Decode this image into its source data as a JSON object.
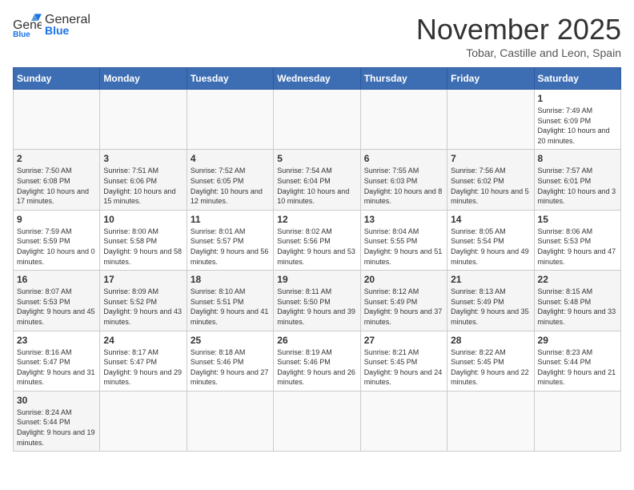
{
  "logo": {
    "text_general": "General",
    "text_blue": "Blue"
  },
  "header": {
    "month_year": "November 2025",
    "location": "Tobar, Castille and Leon, Spain"
  },
  "weekdays": [
    "Sunday",
    "Monday",
    "Tuesday",
    "Wednesday",
    "Thursday",
    "Friday",
    "Saturday"
  ],
  "weeks": [
    [
      null,
      null,
      null,
      null,
      null,
      null,
      {
        "day": "1",
        "sunrise": "7:49 AM",
        "sunset": "6:09 PM",
        "daylight": "10 hours and 20 minutes."
      }
    ],
    [
      {
        "day": "2",
        "sunrise": "7:50 AM",
        "sunset": "6:08 PM",
        "daylight": "10 hours and 17 minutes."
      },
      {
        "day": "3",
        "sunrise": "7:51 AM",
        "sunset": "6:06 PM",
        "daylight": "10 hours and 15 minutes."
      },
      {
        "day": "4",
        "sunrise": "7:52 AM",
        "sunset": "6:05 PM",
        "daylight": "10 hours and 12 minutes."
      },
      {
        "day": "5",
        "sunrise": "7:54 AM",
        "sunset": "6:04 PM",
        "daylight": "10 hours and 10 minutes."
      },
      {
        "day": "6",
        "sunrise": "7:55 AM",
        "sunset": "6:03 PM",
        "daylight": "10 hours and 8 minutes."
      },
      {
        "day": "7",
        "sunrise": "7:56 AM",
        "sunset": "6:02 PM",
        "daylight": "10 hours and 5 minutes."
      },
      {
        "day": "8",
        "sunrise": "7:57 AM",
        "sunset": "6:01 PM",
        "daylight": "10 hours and 3 minutes."
      }
    ],
    [
      {
        "day": "9",
        "sunrise": "7:59 AM",
        "sunset": "5:59 PM",
        "daylight": "10 hours and 0 minutes."
      },
      {
        "day": "10",
        "sunrise": "8:00 AM",
        "sunset": "5:58 PM",
        "daylight": "9 hours and 58 minutes."
      },
      {
        "day": "11",
        "sunrise": "8:01 AM",
        "sunset": "5:57 PM",
        "daylight": "9 hours and 56 minutes."
      },
      {
        "day": "12",
        "sunrise": "8:02 AM",
        "sunset": "5:56 PM",
        "daylight": "9 hours and 53 minutes."
      },
      {
        "day": "13",
        "sunrise": "8:04 AM",
        "sunset": "5:55 PM",
        "daylight": "9 hours and 51 minutes."
      },
      {
        "day": "14",
        "sunrise": "8:05 AM",
        "sunset": "5:54 PM",
        "daylight": "9 hours and 49 minutes."
      },
      {
        "day": "15",
        "sunrise": "8:06 AM",
        "sunset": "5:53 PM",
        "daylight": "9 hours and 47 minutes."
      }
    ],
    [
      {
        "day": "16",
        "sunrise": "8:07 AM",
        "sunset": "5:53 PM",
        "daylight": "9 hours and 45 minutes."
      },
      {
        "day": "17",
        "sunrise": "8:09 AM",
        "sunset": "5:52 PM",
        "daylight": "9 hours and 43 minutes."
      },
      {
        "day": "18",
        "sunrise": "8:10 AM",
        "sunset": "5:51 PM",
        "daylight": "9 hours and 41 minutes."
      },
      {
        "day": "19",
        "sunrise": "8:11 AM",
        "sunset": "5:50 PM",
        "daylight": "9 hours and 39 minutes."
      },
      {
        "day": "20",
        "sunrise": "8:12 AM",
        "sunset": "5:49 PM",
        "daylight": "9 hours and 37 minutes."
      },
      {
        "day": "21",
        "sunrise": "8:13 AM",
        "sunset": "5:49 PM",
        "daylight": "9 hours and 35 minutes."
      },
      {
        "day": "22",
        "sunrise": "8:15 AM",
        "sunset": "5:48 PM",
        "daylight": "9 hours and 33 minutes."
      }
    ],
    [
      {
        "day": "23",
        "sunrise": "8:16 AM",
        "sunset": "5:47 PM",
        "daylight": "9 hours and 31 minutes."
      },
      {
        "day": "24",
        "sunrise": "8:17 AM",
        "sunset": "5:47 PM",
        "daylight": "9 hours and 29 minutes."
      },
      {
        "day": "25",
        "sunrise": "8:18 AM",
        "sunset": "5:46 PM",
        "daylight": "9 hours and 27 minutes."
      },
      {
        "day": "26",
        "sunrise": "8:19 AM",
        "sunset": "5:46 PM",
        "daylight": "9 hours and 26 minutes."
      },
      {
        "day": "27",
        "sunrise": "8:21 AM",
        "sunset": "5:45 PM",
        "daylight": "9 hours and 24 minutes."
      },
      {
        "day": "28",
        "sunrise": "8:22 AM",
        "sunset": "5:45 PM",
        "daylight": "9 hours and 22 minutes."
      },
      {
        "day": "29",
        "sunrise": "8:23 AM",
        "sunset": "5:44 PM",
        "daylight": "9 hours and 21 minutes."
      }
    ],
    [
      {
        "day": "30",
        "sunrise": "8:24 AM",
        "sunset": "5:44 PM",
        "daylight": "9 hours and 19 minutes."
      },
      null,
      null,
      null,
      null,
      null,
      null
    ]
  ]
}
